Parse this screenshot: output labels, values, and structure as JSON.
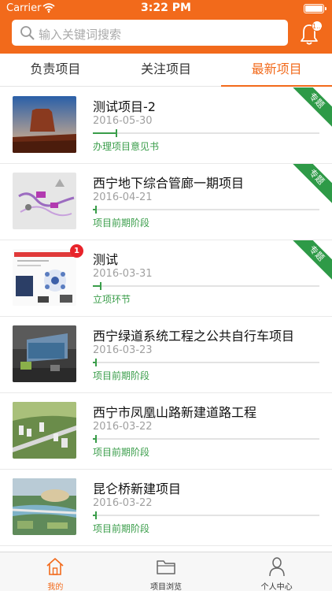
{
  "status_bar": {
    "carrier": "Carrier",
    "time": "3:22 PM"
  },
  "search": {
    "placeholder": "输入关键词搜索"
  },
  "notifications": {
    "badge": "1..."
  },
  "tabs": [
    {
      "label": "负责项目",
      "active": false
    },
    {
      "label": "关注项目",
      "active": false
    },
    {
      "label": "最新项目",
      "active": true
    }
  ],
  "projects": [
    {
      "title": "测试项目-2",
      "date": "2016-05-30",
      "stage": "办理项目意见书",
      "progress": 0.1,
      "ribbon": "专题",
      "badge": ""
    },
    {
      "title": "西宁地下综合管廊一期项目",
      "date": "2016-04-21",
      "stage": "项目前期阶段",
      "progress": 0.01,
      "ribbon": "专题",
      "badge": ""
    },
    {
      "title": "测试",
      "date": "2016-03-31",
      "stage": "立项环节",
      "progress": 0.03,
      "ribbon": "专题",
      "badge": "1"
    },
    {
      "title": "西宁绿道系统工程之公共自行车项目",
      "date": "2016-03-23",
      "stage": "项目前期阶段",
      "progress": 0.01,
      "ribbon": "",
      "badge": ""
    },
    {
      "title": "西宁市凤凰山路新建道路工程",
      "date": "2016-03-22",
      "stage": "项目前期阶段",
      "progress": 0.01,
      "ribbon": "",
      "badge": ""
    },
    {
      "title": "昆仑桥新建项目",
      "date": "2016-03-22",
      "stage": "项目前期阶段",
      "progress": 0.01,
      "ribbon": "",
      "badge": ""
    }
  ],
  "bottom_tabs": [
    {
      "label": "我的",
      "icon": "home-icon",
      "active": true
    },
    {
      "label": "项目浏览",
      "icon": "folder-icon",
      "active": false
    },
    {
      "label": "个人中心",
      "icon": "person-icon",
      "active": false
    }
  ],
  "colors": {
    "accent": "#f26a1b",
    "stage_green": "#3a9d4a",
    "ribbon_green": "#2e9a47"
  }
}
